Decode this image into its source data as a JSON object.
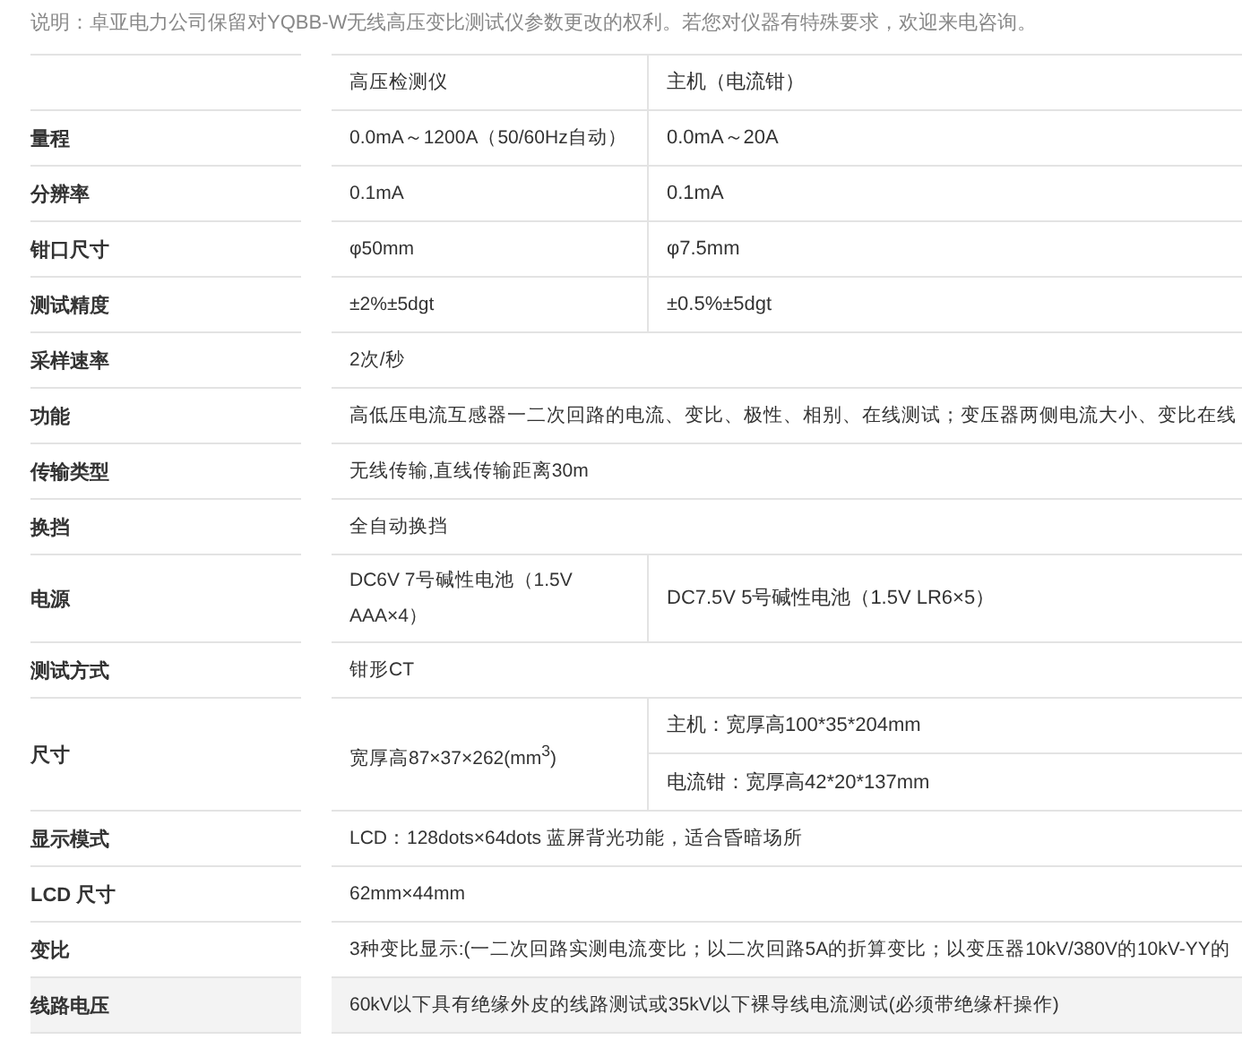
{
  "note": "说明：卓亚电力公司保留对YQBB-W无线高压变比测试仪参数更改的权利。若您对仪器有特殊要求，欢迎来电咨询。",
  "table": {
    "columns": [
      "高压检测仪",
      "主机（电流钳）"
    ],
    "rows": [
      {
        "label": "量程",
        "kind": "split",
        "shaded": false,
        "values": [
          "0.0mA～1200A（50/60Hz自动）",
          "0.0mA～20A"
        ]
      },
      {
        "label": "分辨率",
        "kind": "split",
        "shaded": false,
        "values": [
          "0.1mA",
          "0.1mA"
        ]
      },
      {
        "label": "钳口尺寸",
        "kind": "split",
        "shaded": false,
        "values": [
          "φ50mm",
          "φ7.5mm"
        ]
      },
      {
        "label": "测试精度",
        "kind": "split",
        "shaded": false,
        "values": [
          "±2%±5dgt",
          "±0.5%±5dgt"
        ]
      },
      {
        "label": "采样速率",
        "kind": "span",
        "shaded": false,
        "values": [
          "2次/秒"
        ]
      },
      {
        "label": "功能",
        "kind": "span",
        "shaded": false,
        "values": [
          "高低压电流互感器一二次回路的电流、变比、极性、相别、在线测试；变压器两侧电流大小、变比在线"
        ]
      },
      {
        "label": "传输类型",
        "kind": "span",
        "shaded": false,
        "values": [
          "无线传输,直线传输距离30m"
        ]
      },
      {
        "label": "换挡",
        "kind": "span",
        "shaded": false,
        "values": [
          "全自动换挡"
        ]
      },
      {
        "label": "电源",
        "kind": "split",
        "shaded": false,
        "values": [
          "DC6V 7号碱性电池（1.5V AAA×4）",
          "DC7.5V 5号碱性电池（1.5V LR6×5）"
        ]
      },
      {
        "label": "测试方式",
        "kind": "span",
        "shaded": false,
        "values": [
          "钳形CT"
        ]
      },
      {
        "label": "尺寸",
        "kind": "stacked",
        "shaded": false,
        "values": [
          "宽厚高87×37×262(mm$^{3}$)",
          "主机：宽厚高100*35*204mm",
          "电流钳：宽厚高42*20*137mm"
        ]
      },
      {
        "label": "显示模式",
        "kind": "span",
        "shaded": false,
        "values": [
          "LCD：128dots×64dots 蓝屏背光功能，适合昏暗场所"
        ]
      },
      {
        "label": "LCD 尺寸",
        "kind": "span",
        "shaded": false,
        "values": [
          "62mm×44mm"
        ]
      },
      {
        "label": "变比",
        "kind": "span",
        "shaded": false,
        "values": [
          "3种变比显示:(一二次回路实测电流变比；以二次回路5A的折算变比；以变压器10kV/380V的10kV-YY的"
        ]
      },
      {
        "label": "线路电压",
        "kind": "span",
        "shaded": true,
        "values": [
          "60kV以下具有绝缘外皮的线路测试或35kV以下裸导线电流测试(必须带绝缘杆操作)"
        ]
      }
    ]
  }
}
